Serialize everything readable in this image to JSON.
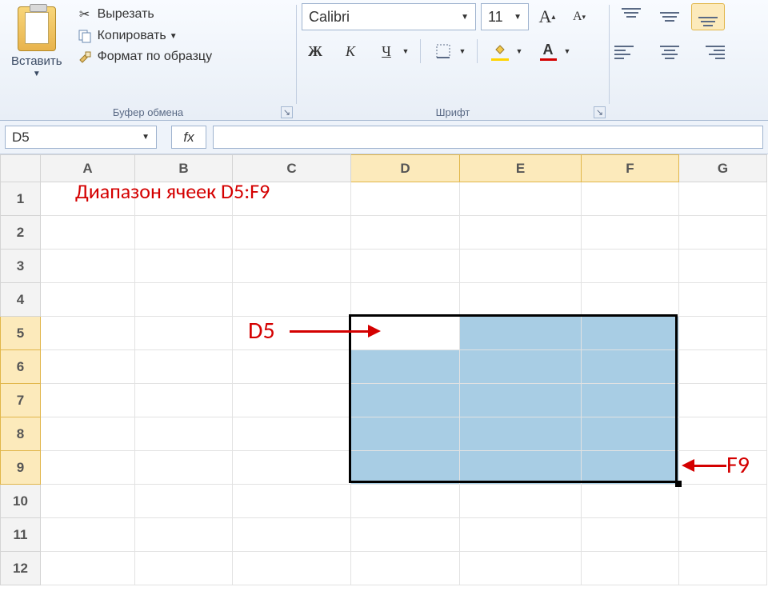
{
  "ribbon": {
    "clipboard": {
      "group_label": "Буфер обмена",
      "paste_label": "Вставить",
      "cut_label": "Вырезать",
      "copy_label": "Копировать",
      "format_painter_label": "Формат по образцу"
    },
    "font": {
      "group_label": "Шрифт",
      "font_name": "Calibri",
      "font_size": "11",
      "bold_glyph": "Ж",
      "italic_glyph": "К",
      "underline_glyph": "Ч",
      "accent_font_color": "#d40000",
      "accent_fill_color": "#ffd400"
    },
    "alignment": {
      "group_label": ""
    }
  },
  "formula_bar": {
    "name_box": "D5",
    "fx_label": "fx",
    "formula_value": ""
  },
  "sheet": {
    "columns": [
      "A",
      "B",
      "C",
      "D",
      "E",
      "F",
      "G"
    ],
    "col_widths": {
      "A": 118,
      "B": 122,
      "C": 148,
      "D": 136,
      "E": 152,
      "F": 122,
      "G": 110
    },
    "rows": [
      1,
      2,
      3,
      4,
      5,
      6,
      7,
      8,
      9,
      10,
      11,
      12
    ],
    "selected_cols": [
      "D",
      "E",
      "F"
    ],
    "selected_rows": [
      5,
      6,
      7,
      8,
      9
    ],
    "active_cell": "D5",
    "selection_range": "D5:F9"
  },
  "annotations": {
    "title": "Диапазон ячеек D5:F9",
    "label_d5": "D5",
    "label_f9": "F9"
  }
}
